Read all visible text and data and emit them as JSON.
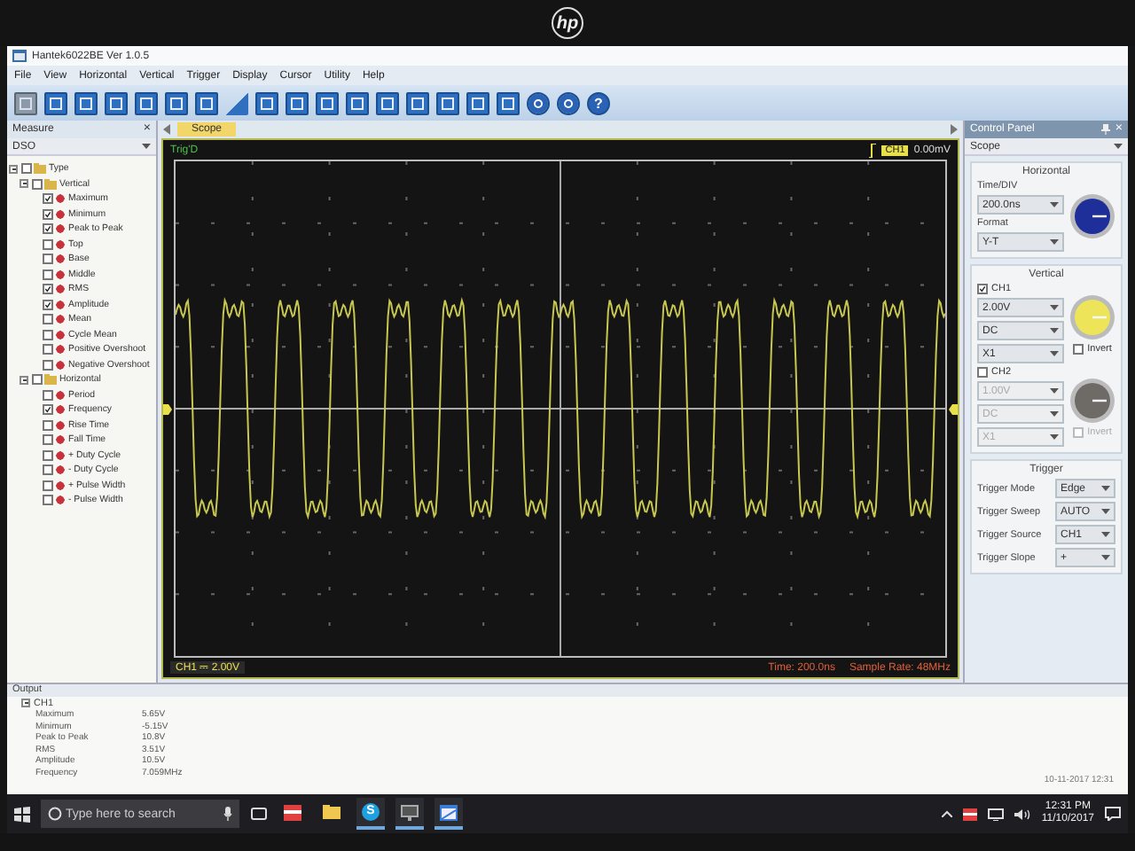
{
  "monitor": {
    "brand": "hp"
  },
  "window": {
    "title": "Hantek6022BE Ver 1.0.5"
  },
  "menu": [
    "File",
    "View",
    "Horizontal",
    "Vertical",
    "Trigger",
    "Display",
    "Cursor",
    "Utility",
    "Help"
  ],
  "toolbar": [
    {
      "kind": "image"
    },
    {
      "kind": "square"
    },
    {
      "kind": "square"
    },
    {
      "kind": "square"
    },
    {
      "kind": "square"
    },
    {
      "kind": "square"
    },
    {
      "kind": "square"
    },
    {
      "kind": "ramp"
    },
    {
      "kind": "square"
    },
    {
      "kind": "square"
    },
    {
      "kind": "square"
    },
    {
      "kind": "square"
    },
    {
      "kind": "square"
    },
    {
      "kind": "square"
    },
    {
      "kind": "square"
    },
    {
      "kind": "square"
    },
    {
      "kind": "square"
    },
    {
      "kind": "play"
    },
    {
      "kind": "pause"
    },
    {
      "kind": "help",
      "label": "?"
    }
  ],
  "measure_panel": {
    "title": "Measure",
    "close": "×",
    "source": "DSO",
    "tree": [
      {
        "label": "Type",
        "checked": false,
        "children": [
          {
            "label": "Vertical",
            "checked": false,
            "children": [
              {
                "label": "Maximum",
                "checked": true
              },
              {
                "label": "Minimum",
                "checked": true
              },
              {
                "label": "Peak to Peak",
                "checked": true
              },
              {
                "label": "Top",
                "checked": false
              },
              {
                "label": "Base",
                "checked": false
              },
              {
                "label": "Middle",
                "checked": false
              },
              {
                "label": "RMS",
                "checked": true
              },
              {
                "label": "Amplitude",
                "checked": true
              },
              {
                "label": "Mean",
                "checked": false
              },
              {
                "label": "Cycle Mean",
                "checked": false
              },
              {
                "label": "Positive Overshoot",
                "checked": false
              },
              {
                "label": "Negative Overshoot",
                "checked": false
              }
            ]
          },
          {
            "label": "Horizontal",
            "checked": false,
            "children": [
              {
                "label": "Period",
                "checked": false
              },
              {
                "label": "Frequency",
                "checked": true
              },
              {
                "label": "Rise Time",
                "checked": false
              },
              {
                "label": "Fall Time",
                "checked": false
              },
              {
                "label": "+ Duty Cycle",
                "checked": false
              },
              {
                "label": "- Duty Cycle",
                "checked": false
              },
              {
                "label": "+ Pulse Width",
                "checked": false
              },
              {
                "label": "- Pulse Width",
                "checked": false
              }
            ]
          }
        ]
      }
    ]
  },
  "scope": {
    "tab": {
      "label": "Scope",
      "selected": true
    },
    "status": "Trig'D",
    "trigger_channel": "CH1",
    "trigger_level": "0.00mV",
    "channel_label": "CH1",
    "coupling": "⎓",
    "volts_div": "2.00V",
    "time": "Time: 200.0ns",
    "sample_rate": "Sample Rate: 48MHz"
  },
  "control_panel": {
    "title": "Control Panel",
    "close": "×",
    "mode": "Scope",
    "horizontal": {
      "heading": "Horizontal",
      "time_div_label": "Time/DIV",
      "time_div": "200.0ns",
      "format_label": "Format",
      "format": "Y-T"
    },
    "vertical": {
      "heading": "Vertical",
      "channels": [
        {
          "label": "CH1",
          "checked": true,
          "enabled": true,
          "volts": "2.00V",
          "coupling": "DC",
          "probe": "X1",
          "invert_label": "Invert",
          "invert": false
        },
        {
          "label": "CH2",
          "checked": false,
          "enabled": false,
          "volts": "1.00V",
          "coupling": "DC",
          "probe": "X1",
          "invert_label": "Invert",
          "invert": false
        }
      ]
    },
    "trigger": {
      "heading": "Trigger",
      "rows": [
        {
          "label": "Trigger Mode",
          "value": "Edge"
        },
        {
          "label": "Trigger Sweep",
          "value": "AUTO"
        },
        {
          "label": "Trigger Source",
          "value": "CH1"
        },
        {
          "label": "Trigger Slope",
          "value": "+"
        }
      ]
    }
  },
  "output": {
    "title": "Output",
    "group": "CH1",
    "rows": [
      {
        "name": "Maximum",
        "value": "5.65V"
      },
      {
        "name": "Minimum",
        "value": "-5.15V"
      },
      {
        "name": "Peak to Peak",
        "value": "10.8V"
      },
      {
        "name": "RMS",
        "value": "3.51V"
      },
      {
        "name": "Amplitude",
        "value": "10.5V"
      },
      {
        "name": "Frequency",
        "value": "7.059MHz"
      }
    ],
    "timestamp": "10-11-2017 12:31"
  },
  "taskbar": {
    "search_placeholder": "Type here to search",
    "apps": [
      {
        "kind": "store",
        "running": false
      },
      {
        "kind": "folder",
        "running": false
      },
      {
        "kind": "chat",
        "label": "S",
        "running": true
      },
      {
        "kind": "monitor",
        "running": true
      },
      {
        "kind": "window",
        "running": true
      }
    ],
    "time": "12:31 PM",
    "date": "11/10/2017"
  }
}
